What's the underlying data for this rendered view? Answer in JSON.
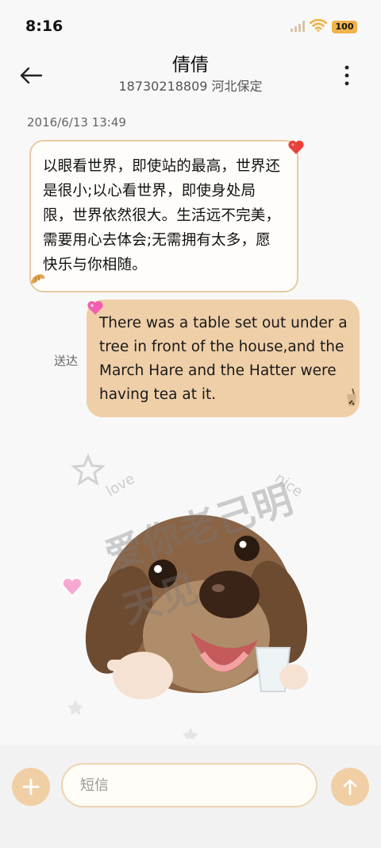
{
  "status_bar": {
    "time": "8:16",
    "battery": "100",
    "icons": [
      "signal-icon",
      "wifi-icon",
      "battery-icon"
    ]
  },
  "header": {
    "contact_name": "倩倩",
    "contact_subtitle": "18730218809 河北保定",
    "back_icon": "arrow-left-icon",
    "menu_icon": "more-vertical-icon"
  },
  "conversation": {
    "timestamp": "2016/6/13 13:49",
    "incoming_message": "以眼看世界，即使站的最高，世界还是很小;以心看世界，即使身处局限，世界依然很大。生活远不完美，需要用心去体会;无需拥有太多，愿快乐与你相随。",
    "outgoing_status": "送达",
    "outgoing_message": "There was a table set out under a tree in front of the house,and the March Hare and the Hatter were having tea at it.",
    "sticker": {
      "text_main": "爱你老己明天见",
      "text_love": "love",
      "text_nice": "nice"
    }
  },
  "composer": {
    "placeholder": "短信",
    "add_icon": "plus-icon",
    "send_icon": "arrow-up-icon"
  },
  "colors": {
    "accent": "#f1cfa5",
    "bubble_out": "#efcfa8",
    "bubble_in_border": "#e7c9a2"
  }
}
